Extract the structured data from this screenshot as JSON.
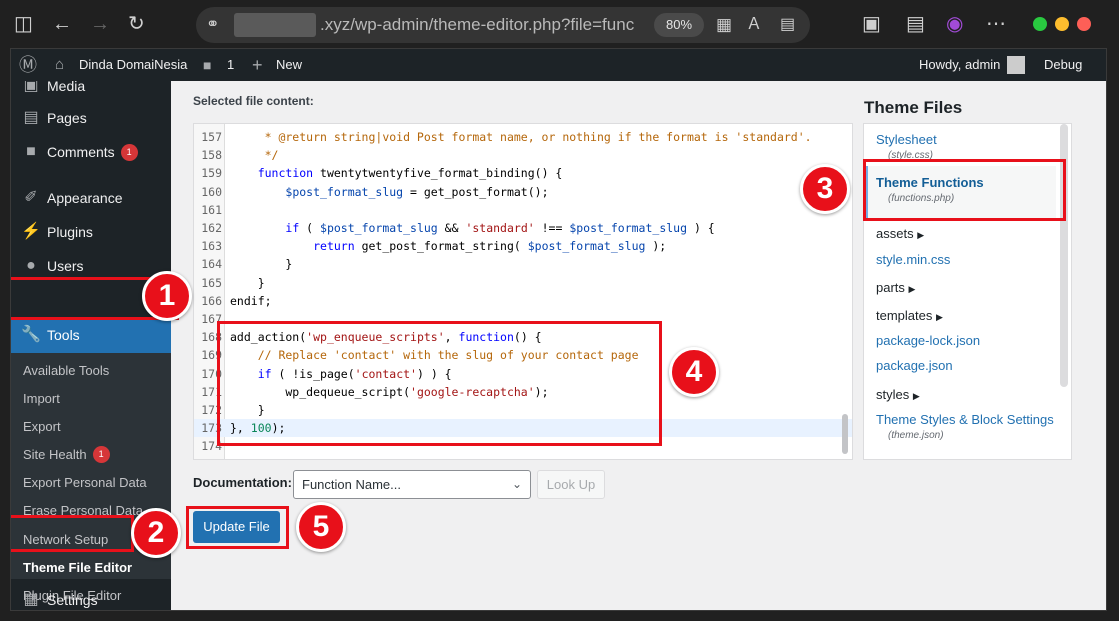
{
  "browser": {
    "url_suffix": ".xyz/wp-admin/theme-editor.php?file=func",
    "zoom": "80%"
  },
  "adminbar": {
    "site_name": "Dinda DomaiNesia",
    "comments_count": "1",
    "new_label": "New",
    "howdy": "Howdy, admin",
    "debug": "Debug"
  },
  "sidebar": {
    "media": "Media",
    "pages": "Pages",
    "comments": "Comments",
    "comments_badge": "1",
    "appearance": "Appearance",
    "plugins": "Plugins",
    "users": "Users",
    "tools": "Tools",
    "settings": "Settings",
    "submenu": [
      {
        "label": "Available Tools"
      },
      {
        "label": "Import"
      },
      {
        "label": "Export"
      },
      {
        "label": "Site Health",
        "badge": "1"
      },
      {
        "label": "Export Personal Data"
      },
      {
        "label": "Erase Personal Data"
      },
      {
        "label": "Network Setup"
      },
      {
        "label": "Theme File Editor"
      },
      {
        "label": "Plugin File Editor"
      }
    ]
  },
  "editor": {
    "label": "Selected file content:",
    "lines": [
      {
        "n": "157",
        "code": "     * @return string|void Post format name, or nothing if the format is 'standard'."
      },
      {
        "n": "158",
        "code": "     */"
      },
      {
        "n": "159",
        "code": "    function twentytwentyfive_format_binding() {"
      },
      {
        "n": "160",
        "code": "        $post_format_slug = get_post_format();"
      },
      {
        "n": "161",
        "code": ""
      },
      {
        "n": "162",
        "code": "        if ( $post_format_slug && 'standard' !== $post_format_slug ) {"
      },
      {
        "n": "163",
        "code": "            return get_post_format_string( $post_format_slug );"
      },
      {
        "n": "164",
        "code": "        }"
      },
      {
        "n": "165",
        "code": "    }"
      },
      {
        "n": "166",
        "code": "endif;"
      },
      {
        "n": "167",
        "code": ""
      },
      {
        "n": "168",
        "code": "add_action('wp_enqueue_scripts', function() {"
      },
      {
        "n": "169",
        "code": "    // Replace 'contact' with the slug of your contact page"
      },
      {
        "n": "170",
        "code": "    if ( !is_page('contact') ) {"
      },
      {
        "n": "171",
        "code": "        wp_dequeue_script('google-recaptcha');"
      },
      {
        "n": "172",
        "code": "    }"
      },
      {
        "n": "173",
        "code": "}, 100);"
      },
      {
        "n": "174",
        "code": ""
      }
    ]
  },
  "files": {
    "title": "Theme Files",
    "items": [
      {
        "name": "Stylesheet",
        "sub": "(style.css)"
      },
      {
        "name": "Theme Functions",
        "sub": "(functions.php)"
      },
      {
        "name": "assets",
        "dir": true
      },
      {
        "name": "style.min.css"
      },
      {
        "name": "parts",
        "dir": true
      },
      {
        "name": "templates",
        "dir": true
      },
      {
        "name": "package-lock.json"
      },
      {
        "name": "package.json"
      },
      {
        "name": "styles",
        "dir": true
      },
      {
        "name": "Theme Styles & Block Settings",
        "sub": "(theme.json)"
      }
    ]
  },
  "documentation": {
    "label": "Documentation:",
    "select_value": "Function Name...",
    "lookup": "Look Up"
  },
  "update_button": "Update File",
  "annotations": [
    "1",
    "2",
    "3",
    "4",
    "5"
  ],
  "colors": {
    "accent": "#2271b1",
    "annotation": "#e8101a",
    "adminbar": "#1d2327"
  }
}
